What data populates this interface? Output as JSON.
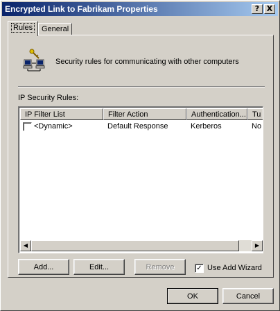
{
  "window": {
    "title": "Encrypted Link to Fabrikam Properties"
  },
  "titlebar_buttons": {
    "help": "?",
    "close": "X"
  },
  "tabs": [
    {
      "label": "Rules"
    },
    {
      "label": "General"
    }
  ],
  "header": {
    "text": "Security rules for communicating with other computers",
    "icon": "network-computers-key-icon"
  },
  "rules": {
    "label": "IP Security Rules:",
    "columns": [
      "IP Filter List",
      "Filter Action",
      "Authentication...",
      "Tu"
    ],
    "rows": [
      {
        "checked": false,
        "cells": [
          "<Dynamic>",
          "Default Response",
          "Kerberos",
          "No"
        ]
      }
    ]
  },
  "actions": {
    "add": "Add...",
    "edit": "Edit...",
    "remove": "Remove"
  },
  "wizard": {
    "label": "Use Add Wizard",
    "checked": true,
    "mark": "✓"
  },
  "footer": {
    "ok": "OK",
    "cancel": "Cancel"
  },
  "scroll": {
    "left": "◀",
    "right": "▶"
  }
}
